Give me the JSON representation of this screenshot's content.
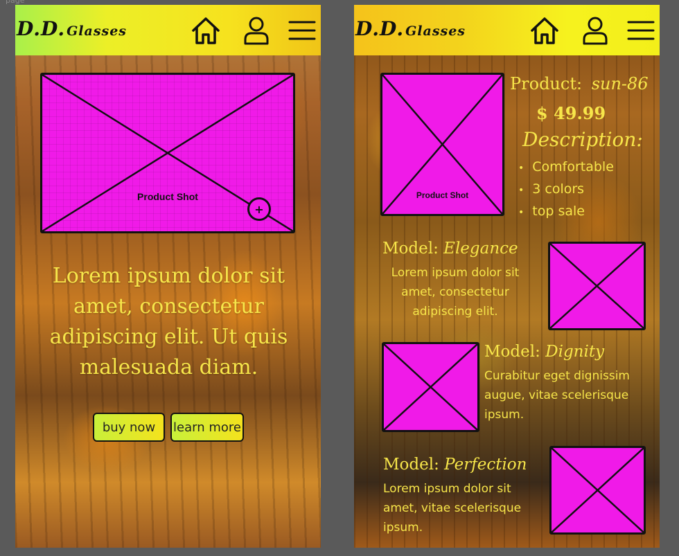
{
  "page_label": "page",
  "brand": {
    "logo_main": "D.D.",
    "logo_sub": "Glasses"
  },
  "colors": {
    "header_yellow": "#f6e21e",
    "header_green": "#a9f04a",
    "placeholder": "#f01ae8",
    "text_yellow": "#f7e64a"
  },
  "left": {
    "product_shot_label": "Product Shot",
    "zoom_symbol": "+",
    "hero_text": "Lorem ipsum dolor sit amet, consectetur adipiscing elit. Ut quis malesuada diam.",
    "buy_label": "buy now",
    "learn_label": "learn more"
  },
  "right": {
    "product_shot_label": "Product Shot",
    "product_label": "Product:",
    "product_name": "sun-86",
    "price": "$ 49.99",
    "description_label": "Description:",
    "features": [
      "Comfortable",
      "3 colors",
      "top sale"
    ],
    "models": [
      {
        "label": "Model:",
        "name": "Elegance",
        "desc": "Lorem ipsum dolor sit amet, consectetur adipiscing elit."
      },
      {
        "label": "Model:",
        "name": "Dignity",
        "desc": "Curabitur eget dignissim augue, vitae scelerisque ipsum."
      },
      {
        "label": "Model:",
        "name": "Perfection",
        "desc": "Lorem ipsum dolor sit amet, vitae scelerisque ipsum."
      }
    ]
  }
}
